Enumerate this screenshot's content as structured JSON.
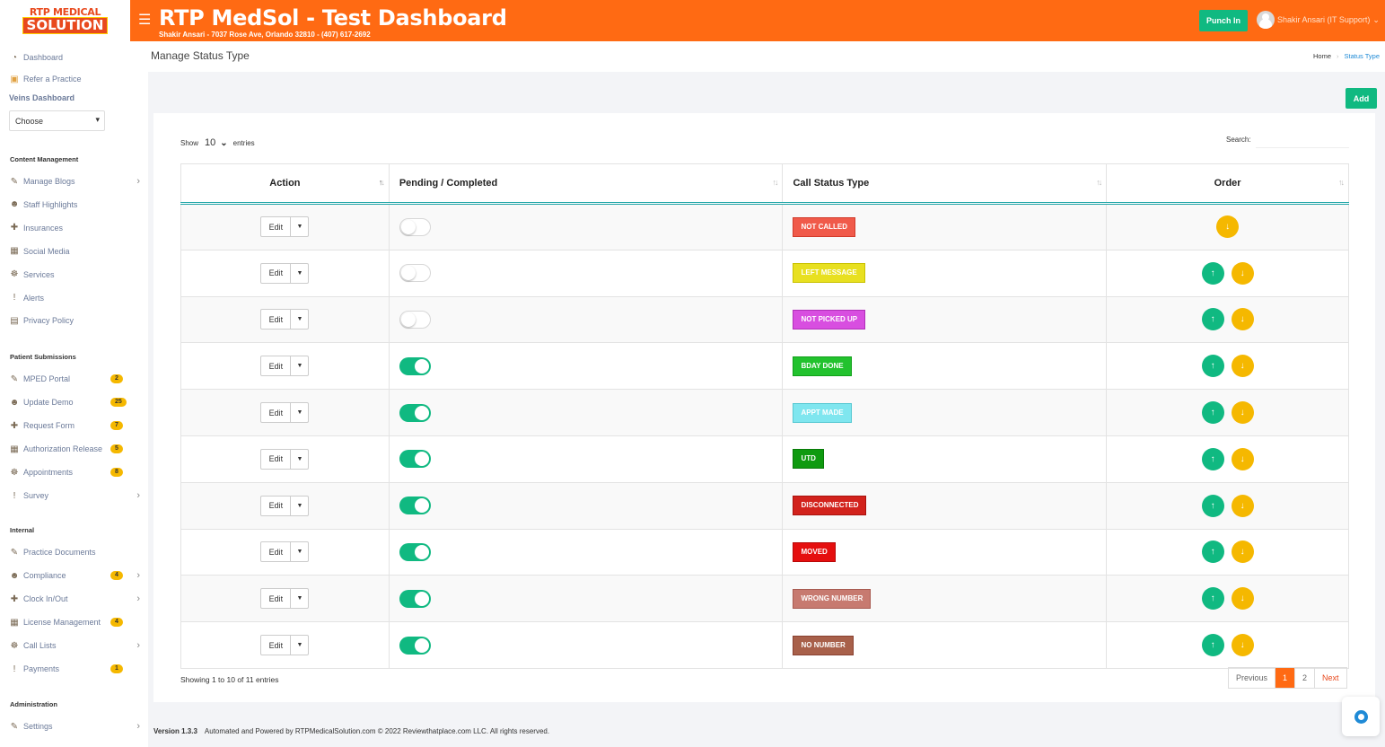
{
  "header": {
    "logo_line1": "RTP MEDICAL",
    "logo_line2": "SOLUTION",
    "title": "RTP MedSol - Test Dashboard",
    "subtitle": "Shakir Ansari - 7037 Rose Ave, Orlando 32810 - (407) 617-2692",
    "punch_label": "Punch In",
    "user_label": "Shakir Ansari (IT Support)",
    "user_caret": "⌄",
    "menu_icon": "☰",
    "accent_color": "#ff6a13"
  },
  "sidebar": {
    "dashboard": "Dashboard",
    "refer": "Refer a Practice",
    "veins_title": "Veins Dashboard",
    "choose_value": "Choose",
    "sections": {
      "content": "Content Management",
      "patient": "Patient Submissions",
      "internal": "Internal",
      "admin": "Administration"
    },
    "content_items": [
      "Manage Blogs",
      "Staff Highlights",
      "Insurances",
      "Social Media",
      "Services",
      "Alerts",
      "Privacy Policy"
    ],
    "patient_items": [
      {
        "label": "MPED Portal",
        "badge": "2"
      },
      {
        "label": "Update Demo",
        "badge": "25"
      },
      {
        "label": "Request Form",
        "badge": "7"
      },
      {
        "label": "Authorization Release",
        "badge": "5"
      },
      {
        "label": "Appointments",
        "badge": "8"
      },
      {
        "label": "Survey",
        "badge": ""
      }
    ],
    "internal_items": [
      {
        "label": "Practice Documents",
        "badge": ""
      },
      {
        "label": "Compliance",
        "badge": "4"
      },
      {
        "label": "Clock In/Out",
        "badge": ""
      },
      {
        "label": "License Management",
        "badge": "4"
      },
      {
        "label": "Call Lists",
        "badge": ""
      },
      {
        "label": "Payments",
        "badge": "1"
      }
    ],
    "admin_items": [
      "Settings"
    ]
  },
  "breadcrumb": {
    "page_title": "Manage Status Type",
    "home": "Home",
    "current": "Status Type"
  },
  "toolbar": {
    "add_label": "Add",
    "show_label": "Show",
    "entries_value": "10",
    "entries_label": "entries",
    "search_label": "Search:",
    "search_value": ""
  },
  "table": {
    "columns": [
      "Action",
      "Pending / Completed",
      "Call Status Type",
      "Order"
    ],
    "edit_label": "Edit",
    "rows": [
      {
        "status": "NOT CALLED",
        "completed": false,
        "bg": "#f05a4a",
        "border": "#d13a2a",
        "color": "#ffffff",
        "up": false
      },
      {
        "status": "LEFT MESSAGE",
        "completed": false,
        "bg": "#e8e020",
        "border": "#c9c100",
        "color": "#ffffff",
        "up": true
      },
      {
        "status": "NOT PICKED UP",
        "completed": false,
        "bg": "#d84ee0",
        "border": "#b02fb8",
        "color": "#ffffff",
        "up": true
      },
      {
        "status": "BDAY DONE",
        "completed": true,
        "bg": "#22c22e",
        "border": "#11a01a",
        "color": "#ffffff",
        "up": true
      },
      {
        "status": "APPT MADE",
        "completed": true,
        "bg": "#7fe6ef",
        "border": "#57c8d2",
        "color": "#ffffff",
        "up": true
      },
      {
        "status": "UTD",
        "completed": true,
        "bg": "#0f9a10",
        "border": "#087a08",
        "color": "#ffffff",
        "up": true
      },
      {
        "status": "DISCONNECTED",
        "completed": true,
        "bg": "#d2221c",
        "border": "#a8120e",
        "color": "#ffffff",
        "up": true
      },
      {
        "status": "MOVED",
        "completed": true,
        "bg": "#e50f0f",
        "border": "#b80808",
        "color": "#ffffff",
        "up": true
      },
      {
        "status": "WRONG NUMBER",
        "completed": true,
        "bg": "#c77a70",
        "border": "#a85a50",
        "color": "#ffffff",
        "up": true
      },
      {
        "status": "NO NUMBER",
        "completed": true,
        "bg": "#a8604a",
        "border": "#884030",
        "color": "#ffffff",
        "up": true
      }
    ]
  },
  "footer_table": {
    "showing": "Showing 1 to 10 of 11 entries",
    "previous": "Previous",
    "pages": [
      "1",
      "2"
    ],
    "next": "Next"
  },
  "footer": {
    "version": "Version 1.3.3",
    "text": "Automated and Powered by RTPMedicalSolution.com © 2022 Reviewthatplace.com LLC. All rights reserved."
  }
}
